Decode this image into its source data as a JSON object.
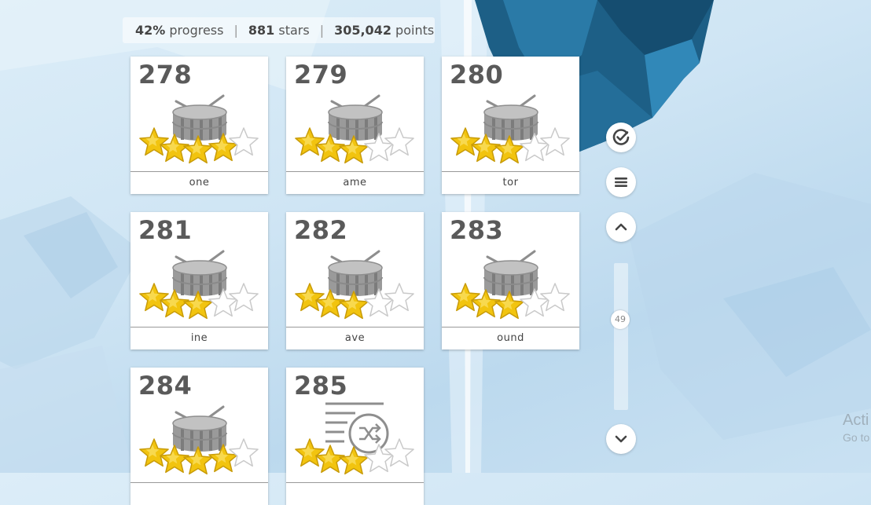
{
  "stats": {
    "progress_value": "42%",
    "progress_label": "progress",
    "stars_value": "881",
    "stars_label": "stars",
    "points_value": "305,042",
    "points_label": "points"
  },
  "levels": [
    {
      "number": "278",
      "name": "one",
      "stars": 4,
      "icon": "drum-icon"
    },
    {
      "number": "279",
      "name": "ame",
      "stars": 3,
      "icon": "drum-icon"
    },
    {
      "number": "280",
      "name": "tor",
      "stars": 3,
      "icon": "drum-icon"
    },
    {
      "number": "281",
      "name": "ine",
      "stars": 3,
      "icon": "drum-icon"
    },
    {
      "number": "282",
      "name": "ave",
      "stars": 3,
      "icon": "drum-icon"
    },
    {
      "number": "283",
      "name": "ound",
      "stars": 3,
      "icon": "drum-icon"
    },
    {
      "number": "284",
      "name": "",
      "stars": 4,
      "icon": "drum-icon"
    },
    {
      "number": "285",
      "name": "",
      "stars": 3,
      "icon": "shuffle-list-icon"
    }
  ],
  "controls": {
    "slider_value": "49",
    "icons": [
      "check-circle-icon",
      "menu-icon",
      "chevron-up-icon",
      "chevron-down-icon"
    ]
  },
  "watermark": {
    "line1": "Acti",
    "line2": "Go to"
  },
  "colors": {
    "star_gold": "#f2c40f",
    "star_empty": "#ffffff",
    "drum_gray": "#9a9a9a",
    "background_blue": "#cfe5f4",
    "ice_dark": "#1d5f86"
  }
}
